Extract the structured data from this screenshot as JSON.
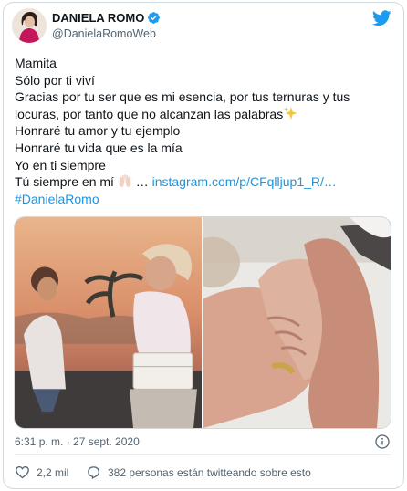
{
  "user": {
    "name": "DANIELA ROMO",
    "handle": "@DanielaRomoWeb"
  },
  "tweet": {
    "lines": [
      "Mamita",
      "Sólo por ti viví",
      "Gracias por tu ser que es mi esencia, por tus ternuras y tus",
      "locuras, por tanto que no alcanzan las palabras",
      "Honraré tu amor y tu ejemplo",
      "Honraré tu vida que es la mía",
      "Yo en ti siempre",
      "Tú siempre en mí"
    ],
    "ellipsis": "…",
    "link_text": "instagram.com/p/CFqlljup1_R/…",
    "hashtag": "#DanielaRomo"
  },
  "meta": {
    "timestamp": "6:31 p. m. · 27 sept. 2020"
  },
  "actions": {
    "likes": "2,2 mil",
    "conversation": "382 personas están twitteando sobre esto"
  },
  "colors": {
    "link": "#1b95e0",
    "verified": "#1d9bf0",
    "twitter_brand": "#1d9bf0",
    "secondary_text": "#536471"
  },
  "icons": {
    "verified": "verified-badge-icon",
    "brand": "twitter-bird-icon",
    "info": "info-icon",
    "like": "heart-icon",
    "reply": "speech-bubble-icon",
    "sparkles": "sparkles-emoji-icon",
    "raised_hands": "raised-hands-emoji-icon"
  }
}
